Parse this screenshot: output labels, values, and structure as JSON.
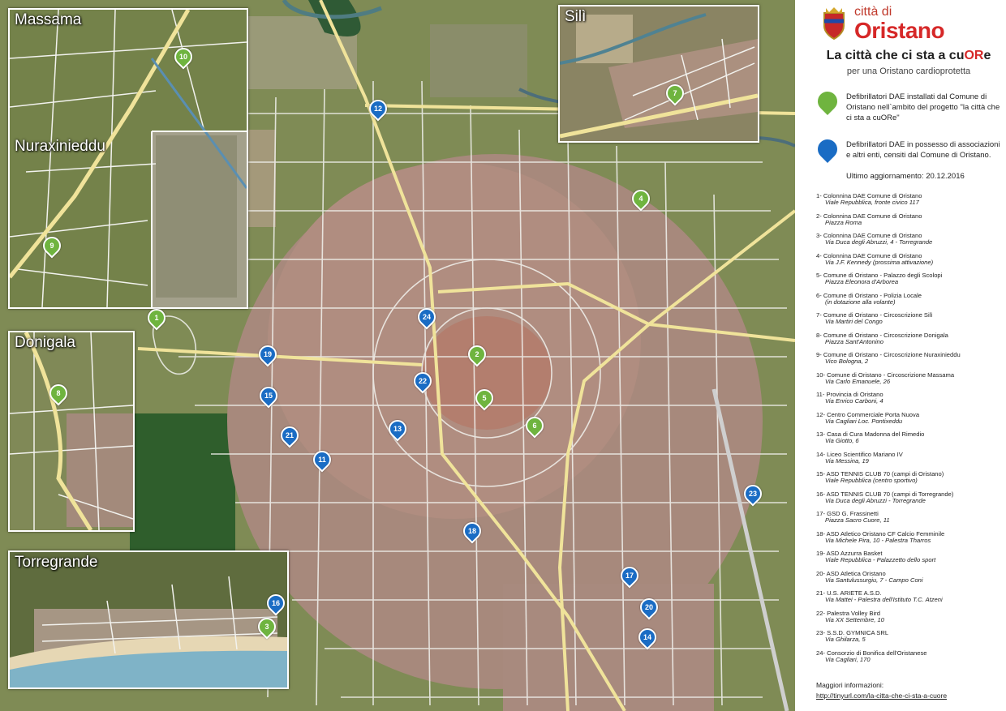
{
  "header": {
    "logo_small": "città di",
    "logo_big": "Oristano",
    "slogan_prefix": "La città che ci sta a cu",
    "slogan_or": "OR",
    "slogan_suffix": "e",
    "subtitle": "per una Oristano cardioprotetta"
  },
  "legend": {
    "green_text": "Defibrillatori DAE installati dal Comune di Oristano nell`ambito del progetto \"la città che ci sta a cuORe\"",
    "blue_text": "Defibrillatori DAE in possesso di associazioni e altri enti, censiti dal Comune di Oristano.",
    "update_text": "Ultimo aggiornamento: 20.12.2016",
    "green_color": "#6fb43f",
    "blue_color": "#1a6cc4"
  },
  "insets": {
    "massama": "Massama",
    "nuraxinieddu": "Nuraxinieddu",
    "donigala": "Donigala",
    "torregrande": "Torregrande",
    "sili": "Silì"
  },
  "markers": [
    {
      "n": "1",
      "color": "green"
    },
    {
      "n": "2",
      "color": "green"
    },
    {
      "n": "3",
      "color": "green"
    },
    {
      "n": "4",
      "color": "green"
    },
    {
      "n": "5",
      "color": "green"
    },
    {
      "n": "6",
      "color": "green"
    },
    {
      "n": "7",
      "color": "green"
    },
    {
      "n": "8",
      "color": "green"
    },
    {
      "n": "9",
      "color": "green"
    },
    {
      "n": "10",
      "color": "green"
    },
    {
      "n": "11",
      "color": "blue"
    },
    {
      "n": "12",
      "color": "blue"
    },
    {
      "n": "13",
      "color": "blue"
    },
    {
      "n": "14",
      "color": "blue"
    },
    {
      "n": "15",
      "color": "blue"
    },
    {
      "n": "16",
      "color": "blue"
    },
    {
      "n": "17",
      "color": "blue"
    },
    {
      "n": "18",
      "color": "blue"
    },
    {
      "n": "19",
      "color": "blue"
    },
    {
      "n": "20",
      "color": "blue"
    },
    {
      "n": "21",
      "color": "blue"
    },
    {
      "n": "22",
      "color": "blue"
    },
    {
      "n": "23",
      "color": "blue"
    },
    {
      "n": "24",
      "color": "blue"
    }
  ],
  "list": [
    {
      "title": "1- Colonnina DAE Comune di Oristano",
      "addr": "Viale Repubblica, fronte civico 117"
    },
    {
      "title": "2- Colonnina DAE Comune di Oristano",
      "addr": "Piazza Roma"
    },
    {
      "title": "3- Colonnina DAE Comune di Oristano",
      "addr": "Via Duca degli Abruzzi, 4 - Torregrande"
    },
    {
      "title": "4- Colonnina DAE Comune di Oristano",
      "addr": "Via J.F. Kennedy (prossima attivazione)"
    },
    {
      "title": "5- Comune di Oristano - Palazzo degli Scolopi",
      "addr": "Piazza Eleonora d'Arborea"
    },
    {
      "title": "6- Comune di Oristano - Polizia Locale",
      "addr": "(in dotazione alla volante)"
    },
    {
      "title": "7- Comune di Oristano - Circoscrizione Silì",
      "addr": "Via Martiri del Congo"
    },
    {
      "title": "8- Comune di Oristano - Circoscrizione Donigala",
      "addr": "Piazza Sant'Antonino"
    },
    {
      "title": "9- Comune di Oristano - Circoscrizione Nuraxinieddu",
      "addr": "Vico Bologna, 2"
    },
    {
      "title": "10- Comune di Oristano - Circoscrizione Massama",
      "addr": "Via Carlo Emanuele, 26"
    },
    {
      "title": "11- Provincia di Oristano",
      "addr": "Via Enrico Carboni, 4"
    },
    {
      "title": "12- Centro Commerciale Porta Nuova",
      "addr": "Via Cagliari Loc. Pontixeddu"
    },
    {
      "title": "13- Casa di Cura Madonna del Rimedio",
      "addr": "Via Giotto, 6"
    },
    {
      "title": "14- Liceo Scientifico Mariano IV",
      "addr": "Via Messina, 19"
    },
    {
      "title": "15- ASD TENNIS CLUB 70 (campi di Oristano)",
      "addr": "Viale Repubblica (centro sportivo)"
    },
    {
      "title": "16- ASD TENNIS CLUB 70 (campi di Torregrande)",
      "addr": "Via Duca degli Abruzzi - Torregrande"
    },
    {
      "title": "17- GSD G. Frassinetti",
      "addr": "Piazza Sacro Cuore, 11"
    },
    {
      "title": "18- ASD Atletico Oristano CF Calcio Femminile",
      "addr": "Via Michele Pira, 10 - Palestra Tharros"
    },
    {
      "title": "19- ASD Azzurra Basket",
      "addr": "Viale Repubblica - Palazzetto dello sport"
    },
    {
      "title": "20- ASD Atletica Oristano",
      "addr": "Via Santulussurgiu, 7 - Campo Coni"
    },
    {
      "title": "21- U.S. ARIETE A.S.D.",
      "addr": "Via Mattei - Palestra dell'Istituto T.C. Atzeni"
    },
    {
      "title": "22- Palestra Volley Bird",
      "addr": "Via XX Settembre, 10"
    },
    {
      "title": "23- S.S.D. GYMNICA SRL",
      "addr": "Via Ghilarza, 5"
    },
    {
      "title": "24- Consorzio di Bonifica dell'Oristanese",
      "addr": "Via Cagliari, 170"
    }
  ],
  "footer": {
    "more": "Maggiori informazioni:",
    "link": "http://tinyurl.com/la-citta-che-ci-sta-a-cuore"
  }
}
